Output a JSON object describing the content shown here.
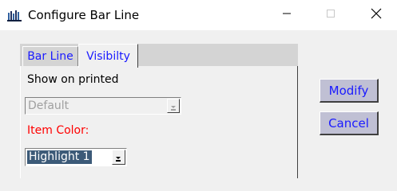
{
  "window": {
    "title": "Configure Bar Line",
    "app_icon": "barline-app-icon",
    "controls": {
      "minimize_icon": "minimize-icon",
      "maximize_icon": "maximize-icon",
      "close_icon": "close-icon"
    }
  },
  "tabs": [
    {
      "label": "Bar Line",
      "active": false
    },
    {
      "label": "Visibilty",
      "active": true
    }
  ],
  "panel": {
    "show_label": "Show on printed",
    "show_select": {
      "value": "Default",
      "enabled": false
    },
    "color_label": "Item Color:",
    "color_select": {
      "value": "Highlight 1",
      "enabled": true
    }
  },
  "buttons": {
    "modify": "Modify",
    "cancel": "Cancel"
  },
  "colors": {
    "tab_text": "#1a1aff",
    "item_color_label": "#ff0000",
    "button_face": "#c0c0d4",
    "selection_bg": "#3c5a78"
  }
}
